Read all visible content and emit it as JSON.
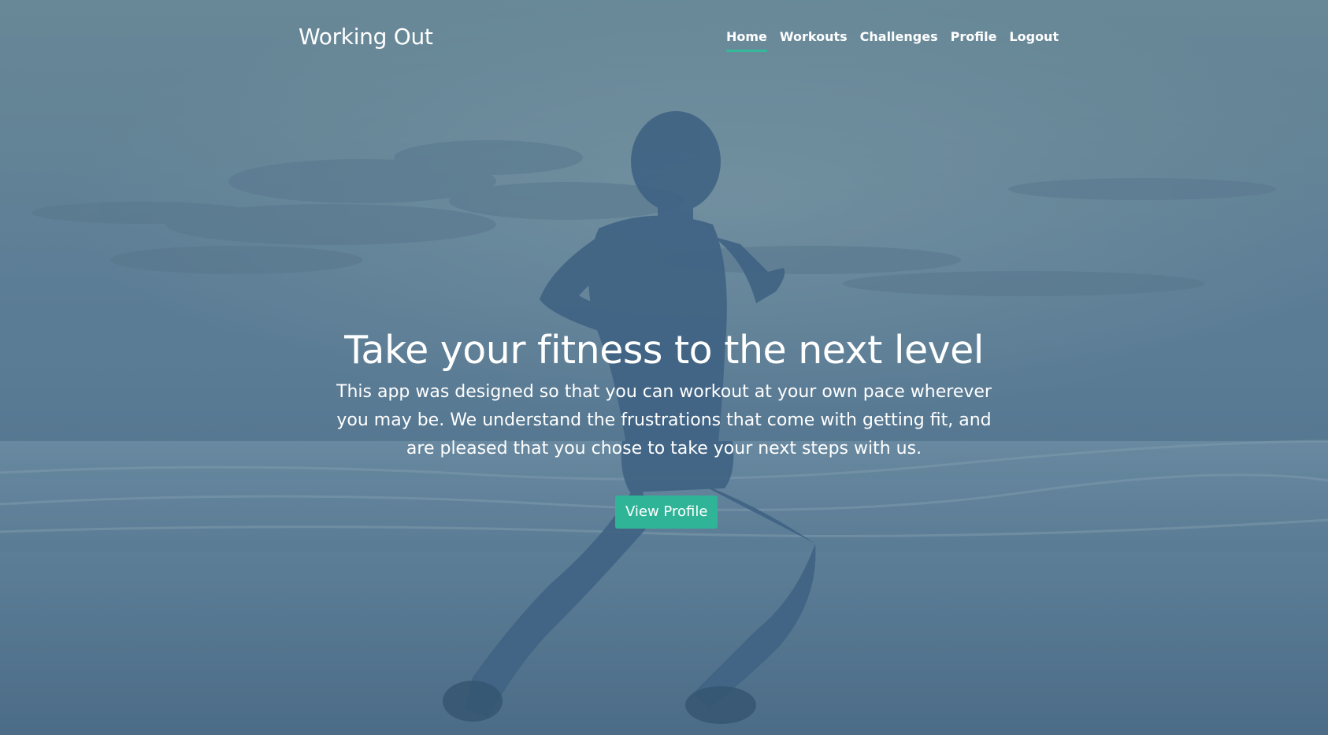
{
  "navbar": {
    "brand": "Working Out",
    "links": [
      {
        "label": "Home",
        "active": true
      },
      {
        "label": "Workouts",
        "active": false
      },
      {
        "label": "Challenges",
        "active": false
      },
      {
        "label": "Profile",
        "active": false
      },
      {
        "label": "Logout",
        "active": false
      }
    ]
  },
  "hero": {
    "title": "Take your fitness to the next level",
    "description": "This app was designed so that you can workout at your own pace wherever you may be. We understand the frustrations that come with getting fit, and are pleased that you chose to take your next steps with us.",
    "cta_label": "View Profile",
    "background_image": "runner-on-beach-photo"
  },
  "colors": {
    "accent": "#30b497",
    "active_underline": "#35b99b",
    "text": "#ffffff",
    "overlay_tint": "#5e7f98"
  }
}
